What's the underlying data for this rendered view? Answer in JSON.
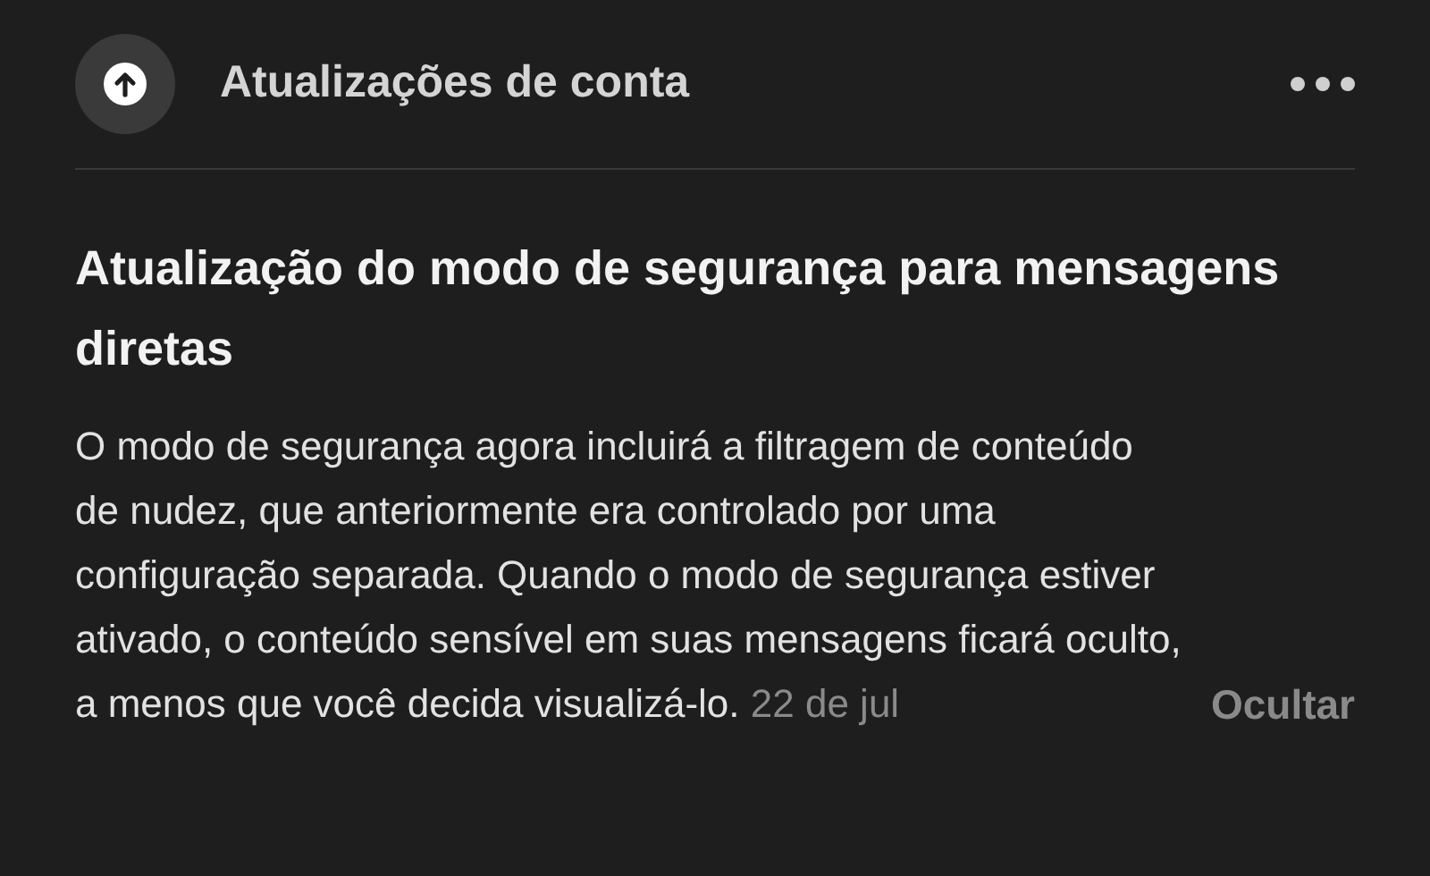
{
  "header": {
    "title": "Atualizações de conta"
  },
  "notice": {
    "title": "Atualização do modo de segurança para mensagens diretas",
    "body": "O modo de segurança agora incluirá a filtragem de conteúdo de nudez, que anteriormente era controlado por uma configuração separada. Quando o modo de segurança estiver ativado, o conteúdo sensível em suas mensagens ficará oculto, a menos que você decida visualizá-lo.",
    "date": "22 de jul",
    "dismiss": "Ocultar"
  }
}
